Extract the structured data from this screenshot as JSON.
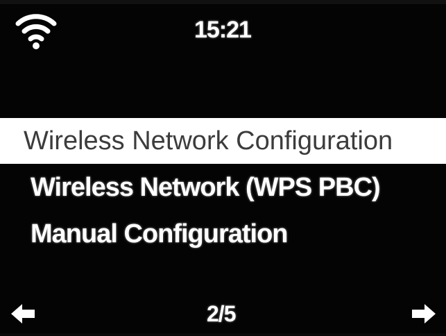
{
  "status_bar": {
    "wifi_icon": "wifi-icon",
    "time": "15:21"
  },
  "menu": {
    "items": [
      {
        "label": "Wireless Network Configuration",
        "selected": true
      },
      {
        "label": "Wireless Network (WPS PBC)",
        "selected": false
      },
      {
        "label": "Manual Configuration",
        "selected": false
      }
    ]
  },
  "footer": {
    "prev_icon": "arrow-left-icon",
    "page": "2/5",
    "next_icon": "arrow-right-icon"
  },
  "colors": {
    "background": "#040404",
    "text": "#ffffff",
    "highlight_bg": "#ffffff",
    "highlight_text": "#3c3c3c"
  }
}
